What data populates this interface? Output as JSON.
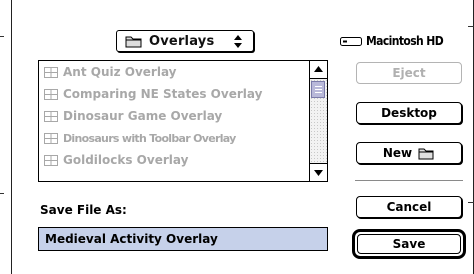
{
  "folder_popup": {
    "label": "Overlays"
  },
  "disk": {
    "name": "Macintosh HD"
  },
  "files": [
    {
      "name": "Ant Quiz Overlay",
      "enabled": false
    },
    {
      "name": "Comparing NE States  Overlay",
      "enabled": false
    },
    {
      "name": "Dinosaur Game Overlay",
      "enabled": false
    },
    {
      "name": "Dinosaurs with Toolbar Overlay",
      "enabled": false
    },
    {
      "name": "Goldilocks Overlay",
      "enabled": false
    }
  ],
  "buttons": {
    "eject": "Eject",
    "desktop": "Desktop",
    "new": "New",
    "cancel": "Cancel",
    "save": "Save"
  },
  "save_as": {
    "label": "Save File As:",
    "value": "Medieval Activity Overlay"
  },
  "colors": {
    "selection": "#c6d1ea",
    "disabled_text": "#a8a8a8",
    "scroll_thumb": "#b9b9d9"
  }
}
